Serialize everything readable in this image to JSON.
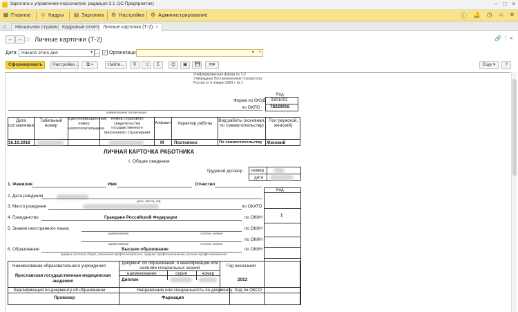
{
  "window": {
    "title": "Зарплата и управление персоналом, редакция 3.1 (1С:Предприятие)"
  },
  "menu": {
    "items": [
      {
        "label": "Главное",
        "icon": "grid-icon"
      },
      {
        "label": "Кадры",
        "icon": "people-icon"
      },
      {
        "label": "Зарплата",
        "icon": "wallet-icon"
      },
      {
        "label": "Настройка",
        "icon": "gear-icon"
      },
      {
        "label": "Администрирование",
        "icon": "cog-icon"
      }
    ]
  },
  "tabs": [
    {
      "label": "Начальная страница"
    },
    {
      "label": "Кадровые отчеты"
    },
    {
      "label": "Личные карточки (Т-2)"
    }
  ],
  "page": {
    "title": "Личные карточки (Т-2)"
  },
  "filter": {
    "date_label": "Дата:",
    "date_value": "Начало этого дня",
    "org_label": "Организация:",
    "org_value": ""
  },
  "toolbar": {
    "generate_label": "Сформировать",
    "settings_label": "Настройки...",
    "find_label": "Найти...",
    "sum_label": "Σ",
    "more_label": "Еще",
    "help_label": "?"
  },
  "report": {
    "form_header": [
      "Унифицированная форма № Т-2",
      "Утверждена Постановлением Госкомстата",
      "России от 5 января 2004 г. № 1"
    ],
    "code_label": "Код",
    "okud_label": "Форма по ОКУД",
    "okud_value": "0301002",
    "okpo_label": "по ОКПО",
    "okpo_value": "78220916",
    "org_caption": "наименование организации",
    "table_headers": [
      "Дата составления",
      "Табельный номер",
      "Идентификационный номер налогоплательщика",
      "Номер страхового свидетельства государственного пенсионного страхования",
      "Алфавит",
      "Характер работы",
      "Вид работы (основная, по совместительству)",
      "Пол (мужской, женский)"
    ],
    "row": {
      "date": "16.10.2018",
      "alphabet": "М",
      "character": "Постоянно",
      "kind": "По совместительству",
      "sex": "Женский"
    },
    "card_title": "ЛИЧНАЯ КАРТОЧКА РАБОТНИКА",
    "section1": "I. Общие сведения",
    "contract_label": "Трудовой договор",
    "number_label": "номер",
    "date_label": "дата",
    "code2_label": "Код",
    "f1": "1. Фамилия",
    "name_label": "Имя",
    "patronymic_label": "Отчество",
    "f2": "2. Дата рождения",
    "f2_caption": "день, месяц, год",
    "f3": "3. Место рождения",
    "okato_label": "по ОКАТО",
    "f4": "4. Гражданство",
    "citizenship": "Граждане Российской Федерации",
    "okin_label": "по ОКИН",
    "okin_value": "1",
    "f5": "5. Знание иностранного языка",
    "lang_caption1": "наименование",
    "lang_caption2": "степень знания",
    "okin2_label": "по ОКИН",
    "lang_caption3": "наименование",
    "lang_caption4": "степень знания",
    "okin3_label": "по ОКИН",
    "f6": "6. Образование",
    "education": "Высшее образование",
    "okin4_label": "по ОКИН",
    "edu_caption": "среднее (полное) общее, начальное профессиональное, среднее профессиональное, высшее профессиональное",
    "edu_table": {
      "col1": "Наименование образовательного учреждения",
      "col2": "Документ об образовании, о квалификации или наличии специальных знаний",
      "col3": "Год окончания",
      "sub1": "наименование",
      "sub2": "серия",
      "sub3": "номер",
      "institution": "Ярославская государственная медицинская академия",
      "document": "Диплом",
      "year": "2013",
      "qual_header": "Квалификация по документу об образовании",
      "spec_header": "Направление или специальность по документу",
      "okso_label": "Код по ОКСО",
      "qualification": "Провизор",
      "specialty": "Фармация"
    }
  }
}
